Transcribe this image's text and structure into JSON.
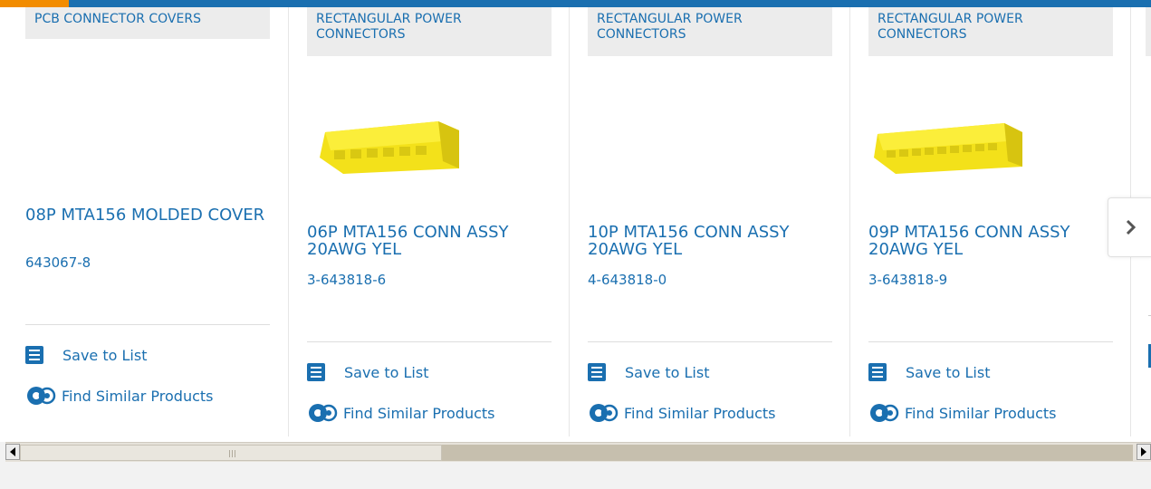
{
  "colors": {
    "brand_blue": "#1a6fb0",
    "accent_orange": "#f28c00",
    "category_bg": "#ececec",
    "connector_yellow": "#f5e21a"
  },
  "cards": [
    {
      "category": "PCB CONNECTOR COVERS",
      "name": "08P MTA156 MOLDED COVER",
      "part_number": "643067-8",
      "save_label": "Save to List",
      "similar_label": "Find Similar Products",
      "has_image": false
    },
    {
      "category": "RECTANGULAR POWER CONNECTORS",
      "name": "06P MTA156 CONN ASSY 20AWG YEL",
      "part_number": "3-643818-6",
      "save_label": "Save to List",
      "similar_label": "Find Similar Products",
      "has_image": true
    },
    {
      "category": "RECTANGULAR POWER CONNECTORS",
      "name": "10P MTA156 CONN ASSY 20AWG YEL",
      "part_number": "4-643818-0",
      "save_label": "Save to List",
      "similar_label": "Find Similar Products",
      "has_image": false
    },
    {
      "category": "RECTANGULAR POWER CONNECTORS",
      "name": "09P MTA156 CONN ASSY 20AWG YEL",
      "part_number": "3-643818-9",
      "save_label": "Save to List",
      "similar_label": "Find Similar Products",
      "has_image": true
    }
  ],
  "carousel": {
    "next_icon": "chevron-right-icon"
  },
  "scrollbar": {
    "left_icon": "arrow-left-icon",
    "right_icon": "arrow-right-icon"
  }
}
